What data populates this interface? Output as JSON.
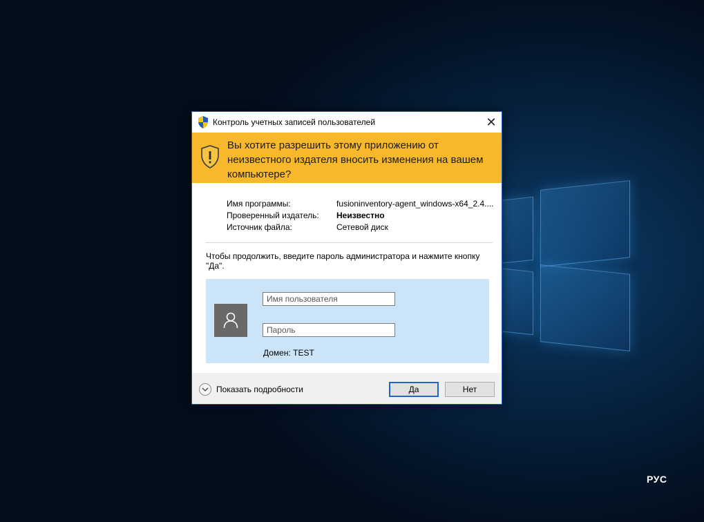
{
  "dialog": {
    "title": "Контроль учетных записей пользователей",
    "close_symbol": "✕",
    "banner_text": "Вы хотите разрешить этому приложению от неизвестного издателя вносить изменения на вашем компьютере?",
    "banner_icon": "shield-warning-icon",
    "info": {
      "program_label": "Имя программы:",
      "program_value": "fusioninventory-agent_windows-x64_2.4....",
      "publisher_label": "Проверенный издатель:",
      "publisher_value": "Неизвестно",
      "source_label": "Источник файла:",
      "source_value": "Сетевой диск"
    },
    "prompt": "Чтобы продолжить, введите пароль администратора и нажмите кнопку \"Да\".",
    "credentials": {
      "avatar_icon": "user-icon",
      "username_placeholder": "Имя пользователя",
      "username_value": "",
      "password_placeholder": "Пароль",
      "password_value": "",
      "domain_text": "Домен: TEST"
    },
    "footer": {
      "details_label": "Показать подробности",
      "yes_label": "Да",
      "no_label": "Нет"
    }
  },
  "taskbar": {
    "language": "РУС"
  },
  "colors": {
    "banner": "#f7b92b",
    "panel": "#cce4f7",
    "accent": "#1e63c7"
  }
}
